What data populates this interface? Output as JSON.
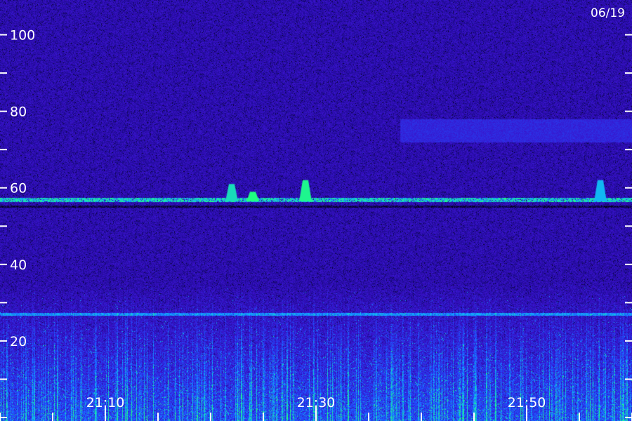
{
  "chart_data": {
    "type": "heatmap",
    "title": "",
    "date_label": "06/19",
    "xlabel": "",
    "ylabel": "",
    "ylim": [
      0,
      110
    ],
    "y_tick_labels": [
      "100",
      "80",
      "60",
      "40",
      "20"
    ],
    "y_tick_label_values": [
      100,
      80,
      60,
      40,
      20
    ],
    "y_minor_tick_values": [
      10,
      30,
      50,
      70,
      90
    ],
    "x_tick_labels": [
      "21:10",
      "21:30",
      "21:50"
    ],
    "xlim_minutes": [
      "21:00",
      "22:00"
    ],
    "colormap": [
      "#000000",
      "#1a0a8c",
      "#3a10c8",
      "#1f50ff",
      "#10b0ff",
      "#20ff80"
    ],
    "features": {
      "band_line": {
        "y": 57,
        "description_units": "y-axis units",
        "intensity": 0.75
      },
      "bursts_on_band": [
        {
          "time": "21:22",
          "height": 4,
          "intensity": 0.8
        },
        {
          "time": "21:24",
          "height": 2,
          "intensity": 1.0
        },
        {
          "time": "21:29",
          "height": 5,
          "intensity": 0.95
        },
        {
          "time": "21:57",
          "height": 5,
          "intensity": 0.6
        }
      ],
      "block_rectangle": {
        "y_range": [
          72,
          78
        ],
        "time_range": [
          "21:38",
          "22:00"
        ]
      },
      "low_band_line": {
        "y": 27
      },
      "noise_floor_top": 35
    }
  }
}
